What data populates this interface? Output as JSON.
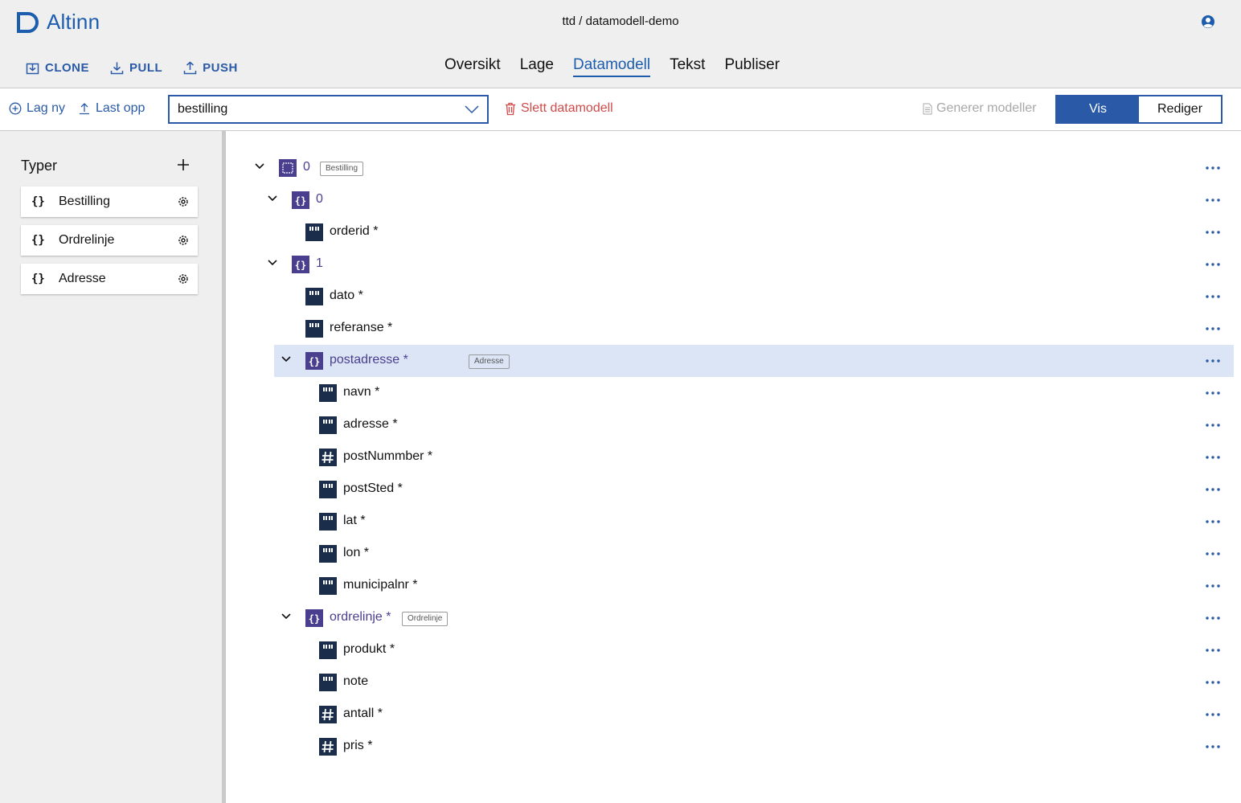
{
  "header": {
    "logo_text": "Altinn",
    "repo_title": "ttd / datamodell-demo",
    "repo_actions": [
      "CLONE",
      "PULL",
      "PUSH"
    ],
    "nav": [
      "Oversikt",
      "Lage",
      "Datamodell",
      "Tekst",
      "Publiser"
    ],
    "active_nav": "Datamodell"
  },
  "toolbar": {
    "create_label": "Lag ny",
    "upload_label": "Last opp",
    "selected_model": "bestilling",
    "delete_label": "Slett datamodell",
    "generate_label": "Generer modeller",
    "view_label": "Vis",
    "edit_label": "Rediger"
  },
  "sidebar": {
    "title": "Typer",
    "types": [
      "Bestilling",
      "Ordrelinje",
      "Adresse"
    ]
  },
  "tree": [
    {
      "label": "0",
      "kind": "root",
      "expanded": true,
      "badge": "Bestilling"
    },
    {
      "label": "0",
      "kind": "object",
      "expanded": true
    },
    {
      "label": "orderid *",
      "kind": "string"
    },
    {
      "label": "1",
      "kind": "object",
      "expanded": true
    },
    {
      "label": "dato *",
      "kind": "string"
    },
    {
      "label": "referanse *",
      "kind": "string"
    },
    {
      "label": "postadresse *",
      "kind": "object",
      "expanded": true,
      "badge": "Adresse",
      "selected": true
    },
    {
      "label": "navn *",
      "kind": "string"
    },
    {
      "label": "adresse *",
      "kind": "string"
    },
    {
      "label": "postNummber *",
      "kind": "number"
    },
    {
      "label": "postSted *",
      "kind": "string"
    },
    {
      "label": "lat *",
      "kind": "string"
    },
    {
      "label": "lon *",
      "kind": "string"
    },
    {
      "label": "municipalnr *",
      "kind": "string"
    },
    {
      "label": "ordrelinje *",
      "kind": "array",
      "expanded": true,
      "badge": "Ordrelinje"
    },
    {
      "label": "produkt *",
      "kind": "string"
    },
    {
      "label": "note",
      "kind": "string"
    },
    {
      "label": "antall *",
      "kind": "number"
    },
    {
      "label": "pris *",
      "kind": "number"
    }
  ],
  "colors": {
    "brand": "#1d5dad",
    "accent": "#2a5aa7",
    "danger": "#d04a4a",
    "selected_row": "#dce5f5",
    "icon_object": "#4a3f8f",
    "icon_field": "#1a2d4a"
  }
}
